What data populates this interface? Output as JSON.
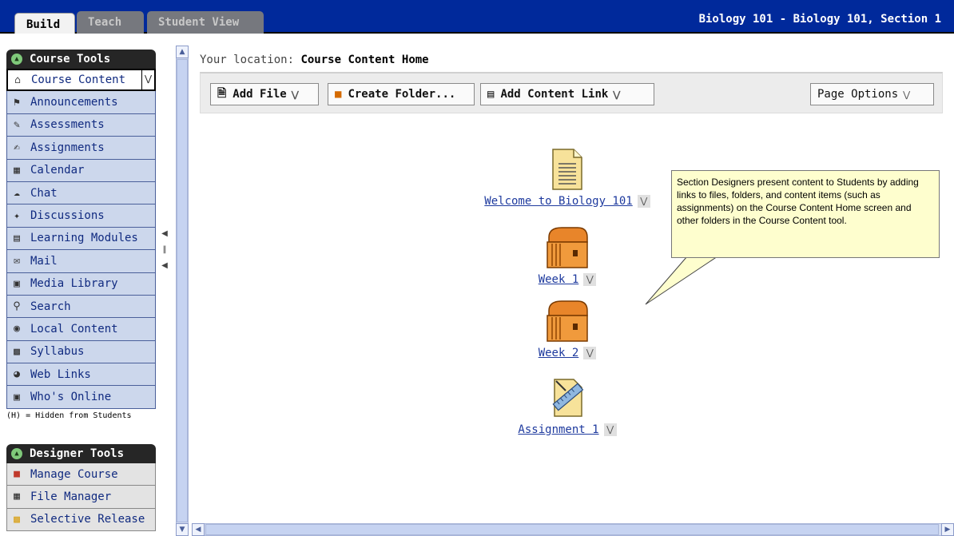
{
  "tabs": [
    {
      "label": "Build",
      "active": true
    },
    {
      "label": "Teach",
      "active": false
    },
    {
      "label": "Student View",
      "active": false
    }
  ],
  "course_title": "Biology 101 - Biology 101, Section 1",
  "course_tools": {
    "header": "Course Tools",
    "items": [
      {
        "label": "Course Content",
        "icon": "home-icon",
        "selected": true
      },
      {
        "label": "Announcements",
        "icon": "megaphone-icon"
      },
      {
        "label": "Assessments",
        "icon": "assessment-icon"
      },
      {
        "label": "Assignments",
        "icon": "assignment-icon"
      },
      {
        "label": "Calendar",
        "icon": "calendar-icon"
      },
      {
        "label": "Chat",
        "icon": "chat-icon"
      },
      {
        "label": "Discussions",
        "icon": "pushpin-icon"
      },
      {
        "label": "Learning Modules",
        "icon": "module-icon"
      },
      {
        "label": "Mail",
        "icon": "mail-icon"
      },
      {
        "label": "Media Library",
        "icon": "library-icon"
      },
      {
        "label": "Search",
        "icon": "search-icon"
      },
      {
        "label": "Local Content",
        "icon": "disc-icon"
      },
      {
        "label": "Syllabus",
        "icon": "syllabus-icon"
      },
      {
        "label": "Web Links",
        "icon": "globe-icon"
      },
      {
        "label": "Who's Online",
        "icon": "person-icon"
      }
    ],
    "hidden_note": "(H) = Hidden from Students"
  },
  "designer_tools": {
    "header": "Designer Tools",
    "items": [
      {
        "label": "Manage Course",
        "icon": "toolbox-icon"
      },
      {
        "label": "File Manager",
        "icon": "file-manager-icon"
      },
      {
        "label": "Selective Release",
        "icon": "release-icon"
      }
    ]
  },
  "location": {
    "prefix": "Your location:",
    "value": "Course Content Home"
  },
  "toolbar": {
    "add_file": "Add File",
    "create_folder": "Create Folder...",
    "add_content_link": "Add Content Link",
    "page_options": "Page Options"
  },
  "content_items": [
    {
      "label": "Welcome to Biology 101",
      "icon": "document-icon"
    },
    {
      "label": "Week 1",
      "icon": "folder-box-icon"
    },
    {
      "label": "Week 2",
      "icon": "folder-box-icon"
    },
    {
      "label": "Assignment 1",
      "icon": "assignment-ruler-icon"
    }
  ],
  "callout": "Section Designers present content to Students by adding links to files, folders, and content items (such as assignments) on the Course Content Home screen and other folders in the Course Content tool.",
  "colors": {
    "topbar": "#00299b",
    "nav_item_bg": "#ccd7ec",
    "link": "#1e3a9e",
    "callout_bg": "#fefece"
  }
}
